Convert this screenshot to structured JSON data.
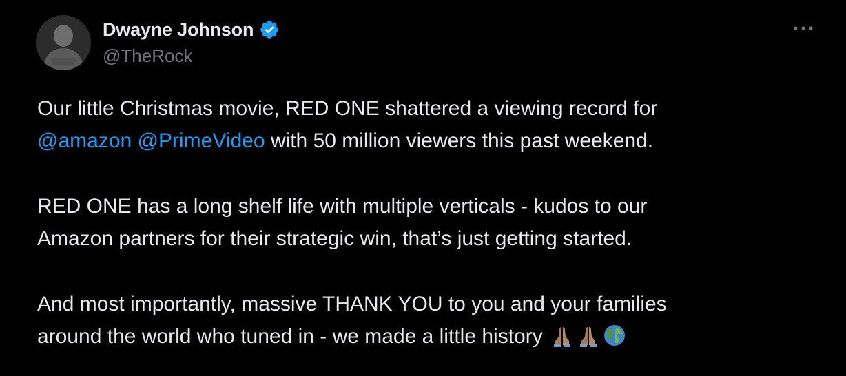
{
  "author": {
    "display_name": "Dwayne Johnson",
    "handle": "@TheRock",
    "verified": true,
    "avatar_icon": "profile-photo"
  },
  "more_icon": "ellipsis-icon",
  "tweet": {
    "p1_a": "Our little Christmas movie, RED ONE shattered a viewing record for",
    "mention_1": "@amazon",
    "mention_2": "@PrimeVideo",
    "p1_b": "with 50 million viewers this past weekend.",
    "p2_a": "RED ONE has a long shelf life with multiple verticals - kudos to our",
    "p2_b": "Amazon partners for their strategic win, that’s just getting started.",
    "p3_a": "And most importantly, massive THANK YOU to you and your families",
    "p3_b": "around the world who tuned in - we made a little history",
    "emojis": [
      "folded-hands-icon",
      "folded-hands-icon",
      "globe-icon"
    ]
  },
  "colors": {
    "background": "#000000",
    "text": "#e7e9ea",
    "secondary_text": "#71767b",
    "link": "#1d9bf0",
    "verified_badge": "#1d9bf0"
  }
}
